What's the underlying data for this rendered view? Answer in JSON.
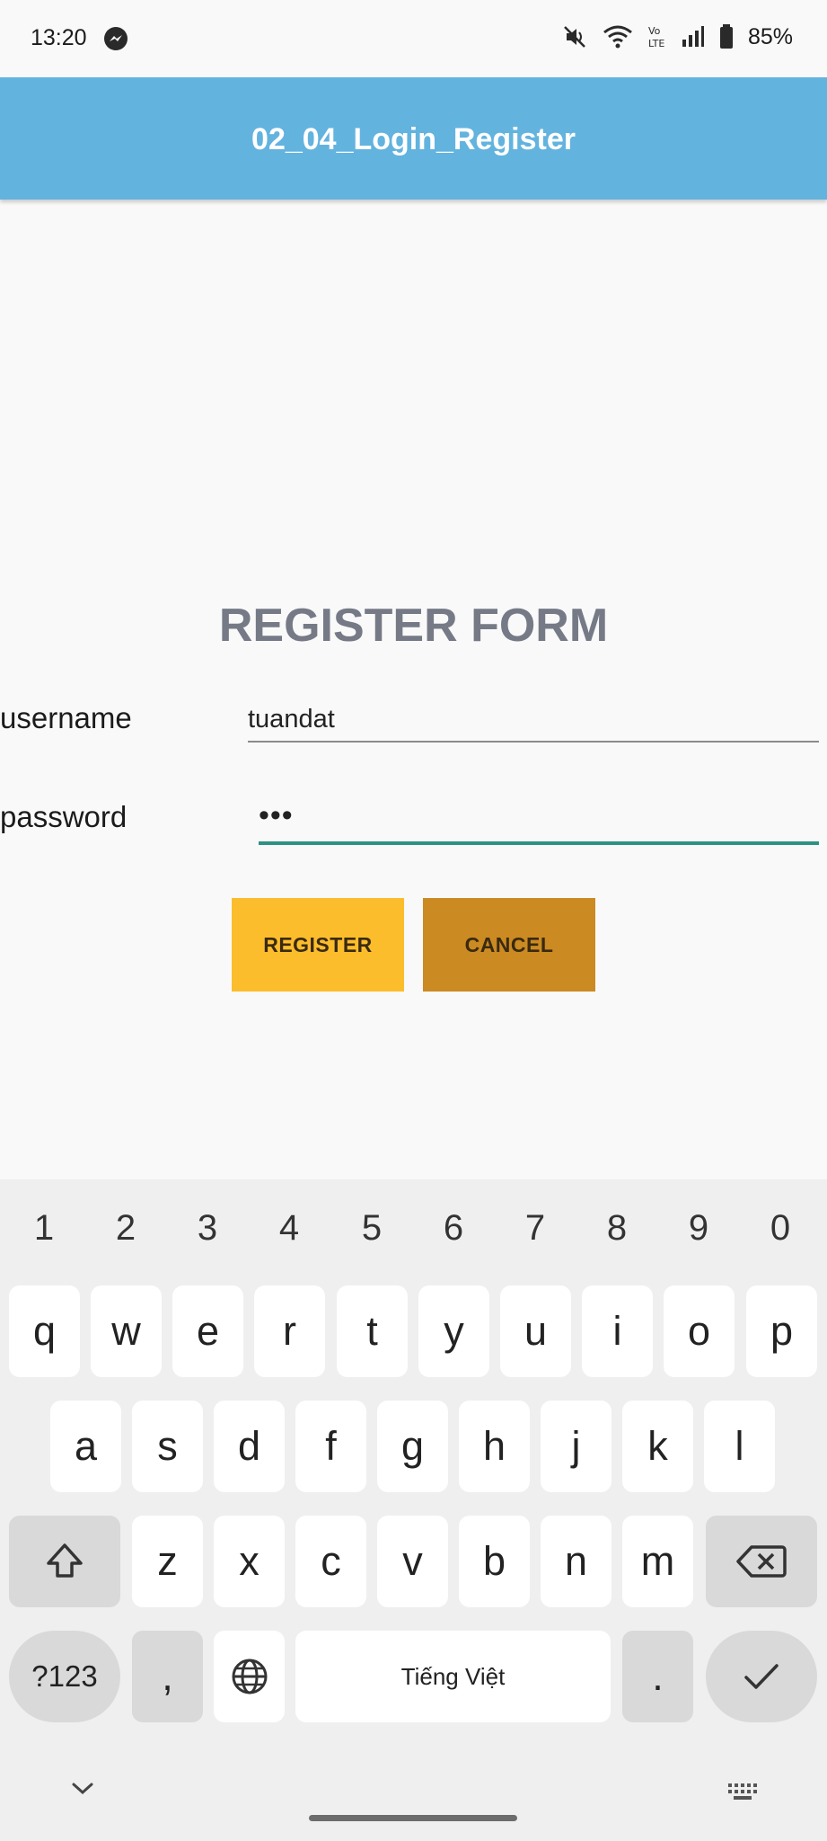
{
  "status_bar": {
    "time": "13:20",
    "battery": "85%",
    "icons": [
      "messenger-icon",
      "mute-icon",
      "wifi-icon",
      "volte-icon",
      "signal-icon",
      "battery-icon"
    ]
  },
  "app_bar": {
    "title": "02_04_Login_Register"
  },
  "form": {
    "title": "REGISTER FORM",
    "username_label": "username",
    "username_value": "tuandat",
    "password_label": "password",
    "password_value": "•••",
    "register_label": "REGISTER",
    "cancel_label": "CANCEL"
  },
  "colors": {
    "app_bar": "#63b3df",
    "register_button": "#fcbd2c",
    "cancel_button": "#cb8a22",
    "focused_underline": "#2e9283"
  },
  "keyboard": {
    "numbers": [
      "1",
      "2",
      "3",
      "4",
      "5",
      "6",
      "7",
      "8",
      "9",
      "0"
    ],
    "row1": [
      "q",
      "w",
      "e",
      "r",
      "t",
      "y",
      "u",
      "i",
      "o",
      "p"
    ],
    "row2": [
      "a",
      "s",
      "d",
      "f",
      "g",
      "h",
      "j",
      "k",
      "l"
    ],
    "row3": [
      "z",
      "x",
      "c",
      "v",
      "b",
      "n",
      "m"
    ],
    "symbols_label": "?123",
    "comma_label": ",",
    "space_label": "Tiếng Việt",
    "period_label": "."
  }
}
